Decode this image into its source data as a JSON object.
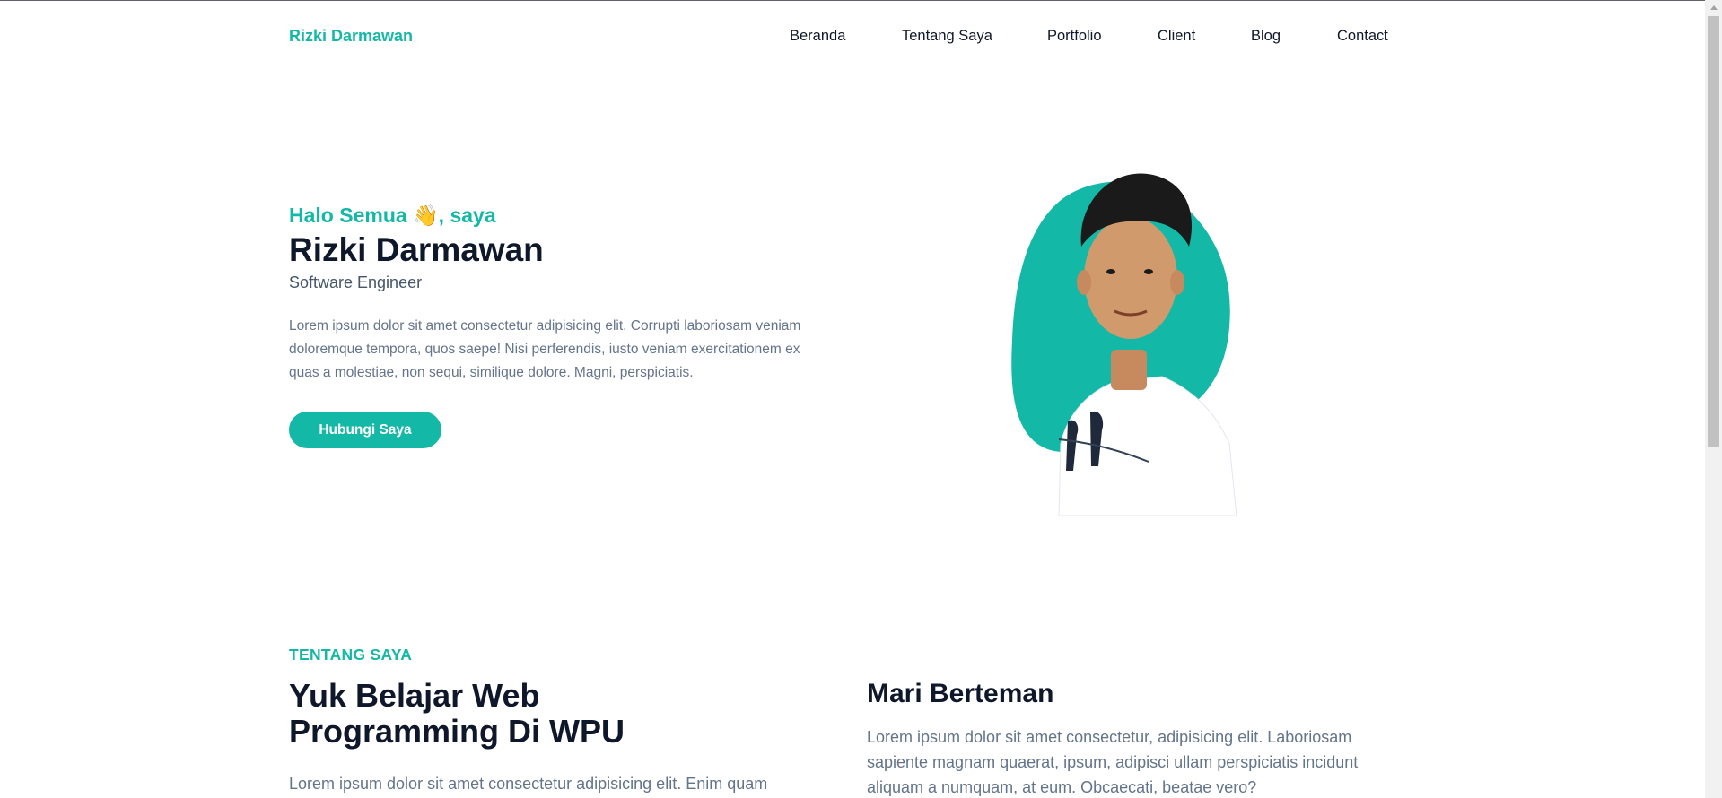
{
  "brand": "Rizki Darmawan",
  "nav": [
    "Beranda",
    "Tentang Saya",
    "Portfolio",
    "Client",
    "Blog",
    "Contact"
  ],
  "hero": {
    "greeting": "Halo Semua 👋, saya",
    "name": "Rizki Darmawan",
    "role": "Software Engineer",
    "description": "Lorem ipsum dolor sit amet consectetur adipisicing elit. Corrupti laboriosam veniam doloremque tempora, quos saepe! Nisi perferendis, iusto veniam exercitationem ex quas a molestiae, non sequi, similique dolore. Magni, perspiciatis.",
    "button": "Hubungi Saya"
  },
  "about": {
    "label": "TENTANG SAYA",
    "title": "Yuk Belajar Web Programming Di WPU",
    "description": "Lorem ipsum dolor sit amet consectetur adipisicing elit. Enim quam"
  },
  "friend": {
    "title": "Mari Berteman",
    "description": "Lorem ipsum dolor sit amet consectetur, adipisicing elit. Laboriosam sapiente magnam quaerat, ipsum, adipisci ullam perspiciatis incidunt aliquam a numquam, at eum. Obcaecati, beatae vero?"
  },
  "colors": {
    "accent": "#14b8a6",
    "heading": "#0f172a",
    "body_text": "#64748b"
  },
  "icons": {
    "profile_photo": "profile-photo",
    "scroll_up": "chevron-up-icon"
  }
}
